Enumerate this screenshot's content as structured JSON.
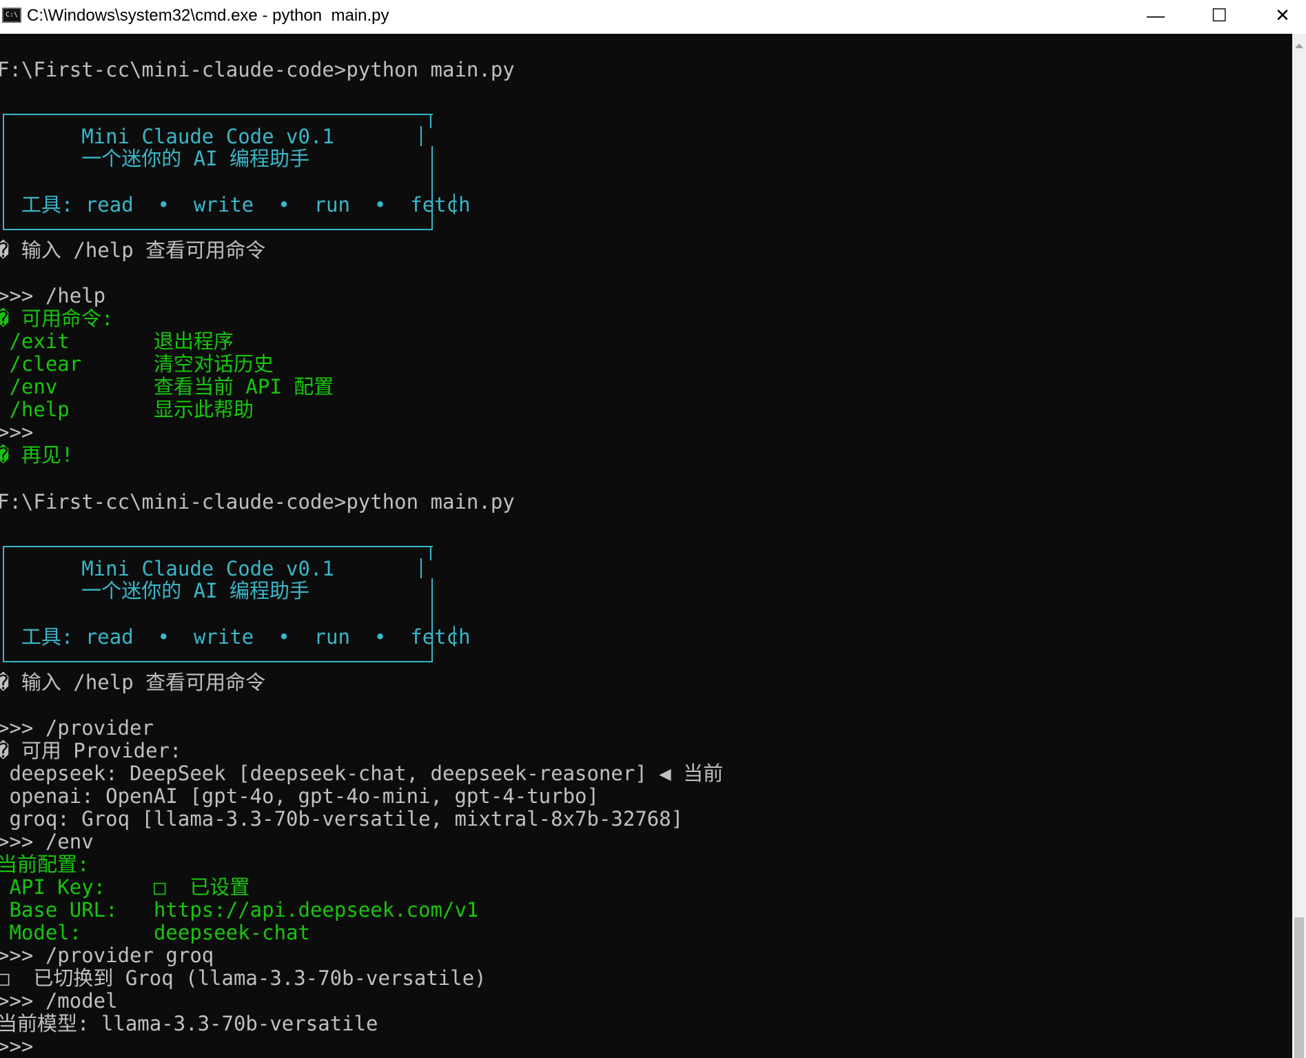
{
  "window": {
    "title": "C:\\Windows\\system32\\cmd.exe - python  main.py",
    "icon": "C:\\",
    "minimize": "—",
    "maximize": "☐",
    "close": "✕"
  },
  "terminal": {
    "lines": [
      "F:\\First-cc\\mini-claude-code>python main.py",
      "       Mini Claude Code v0.1",
      "       一个迷你的 AI 编程助手",
      "  工具: read  •  write  •  run  •  fetch",
      "� 输入 /help 查看可用命令",
      ">>> /help",
      "� 可用命令:",
      " /exit       退出程序",
      " /clear      清空对话历史",
      " /env        查看当前 API 配置",
      " /help       显示此帮助",
      ">>>",
      "� 再见!",
      "F:\\First-cc\\mini-claude-code>python main.py",
      "       Mini Claude Code v0.1",
      "       一个迷你的 AI 编程助手",
      "  工具: read  •  write  •  run  •  fetch",
      "� 输入 /help 查看可用命令",
      ">>> /provider",
      "� 可用 Provider:",
      " deepseek: DeepSeek [deepseek-chat, deepseek-reasoner] ◀ 当前",
      " openai: OpenAI [gpt-4o, gpt-4o-mini, gpt-4-turbo]",
      " groq: Groq [llama-3.3-70b-versatile, mixtral-8x7b-32768]",
      ">>> /env",
      "当前配置:",
      " API Key:    □  已设置",
      " Base URL:   https://api.deepseek.com/v1",
      " Model:      deepseek-chat",
      ">>> /provider groq",
      "□  已切换到 Groq (llama-3.3-70b-versatile)",
      ">>> /model",
      "当前模型: llama-3.3-70b-versatile",
      ">>>"
    ]
  },
  "colors": {
    "background": "#0c0c0c",
    "text": "#c0c0c0",
    "cyan": "#3ab7c9",
    "green": "#16c60c"
  }
}
